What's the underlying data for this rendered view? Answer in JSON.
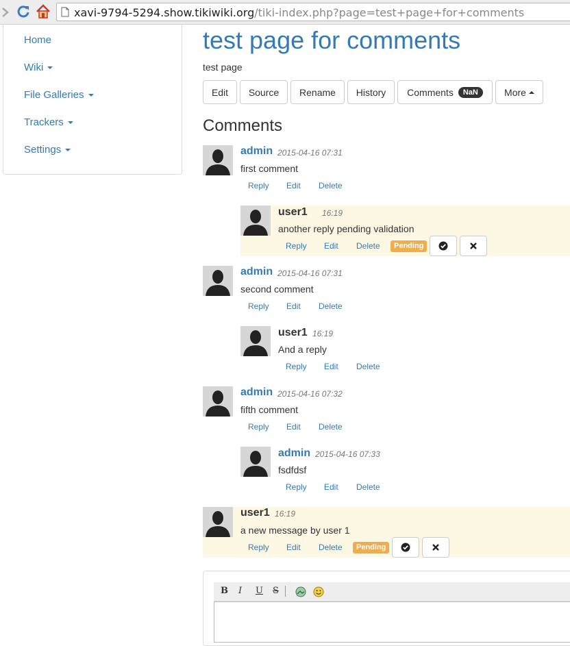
{
  "browser": {
    "url_host": "xavi-9794-5294.show.tikiwiki.org",
    "url_path": "/tiki-index.php?page=test+page+for+comments"
  },
  "sidebar": {
    "items": [
      {
        "label": "Home",
        "dropdown": false
      },
      {
        "label": "Wiki",
        "dropdown": true
      },
      {
        "label": "File Galleries",
        "dropdown": true
      },
      {
        "label": "Trackers",
        "dropdown": true
      },
      {
        "label": "Settings",
        "dropdown": true
      }
    ]
  },
  "page": {
    "title": "test page for comments",
    "description": "test page"
  },
  "toolbar": {
    "edit": "Edit",
    "source": "Source",
    "rename": "Rename",
    "history": "History",
    "comments": "Comments",
    "comments_count": "NaN",
    "more": "More"
  },
  "comments_section": {
    "title": "Comments",
    "reply": "Reply",
    "edit": "Edit",
    "delete": "Delete",
    "pending": "Pending",
    "items": [
      {
        "author": "admin",
        "time": "2015-04-16 07:31",
        "body": "first comment"
      },
      {
        "author": "user1",
        "time": "16:19",
        "body": "another reply pending validation"
      },
      {
        "author": "admin",
        "time": "2015-04-16 07:31",
        "body": "second comment"
      },
      {
        "author": "user1",
        "time": "16:19",
        "body": "And a reply"
      },
      {
        "author": "admin",
        "time": "2015-04-16 07:32",
        "body": "fifth comment"
      },
      {
        "author": "admin",
        "time": "2015-04-16 07:33",
        "body": "fsdfdsf"
      },
      {
        "author": "user1",
        "time": "16:19",
        "body": "a new message by user 1"
      }
    ]
  },
  "editor_toolbar": {
    "bold": "B",
    "italic": "I",
    "underline": "U",
    "strike": "S"
  },
  "colors": {
    "link": "#337ab7",
    "pending_bg": "#fcf8e3",
    "pending_label": "#f0ad4e"
  }
}
